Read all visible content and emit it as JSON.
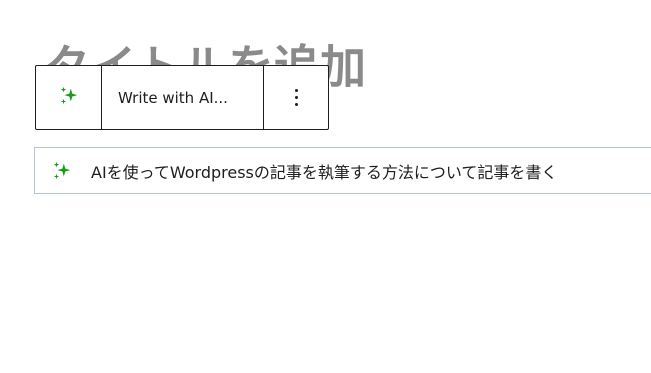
{
  "page": {
    "title": "タイトルを追加"
  },
  "toolbar": {
    "ai_icon": "sparkles-icon",
    "write_with_ai_label": "Write with AI...",
    "more_icon": "more-vertical-icon"
  },
  "prompt": {
    "icon": "sparkles-icon",
    "text": "AIを使ってWordpressの記事を執筆する方法について記事を書く"
  },
  "colors": {
    "accent_green": "#1a9c1a",
    "border_dark": "#1e1e1e",
    "title_gray": "#8a8a8a",
    "field_border": "#b5c4e0"
  }
}
